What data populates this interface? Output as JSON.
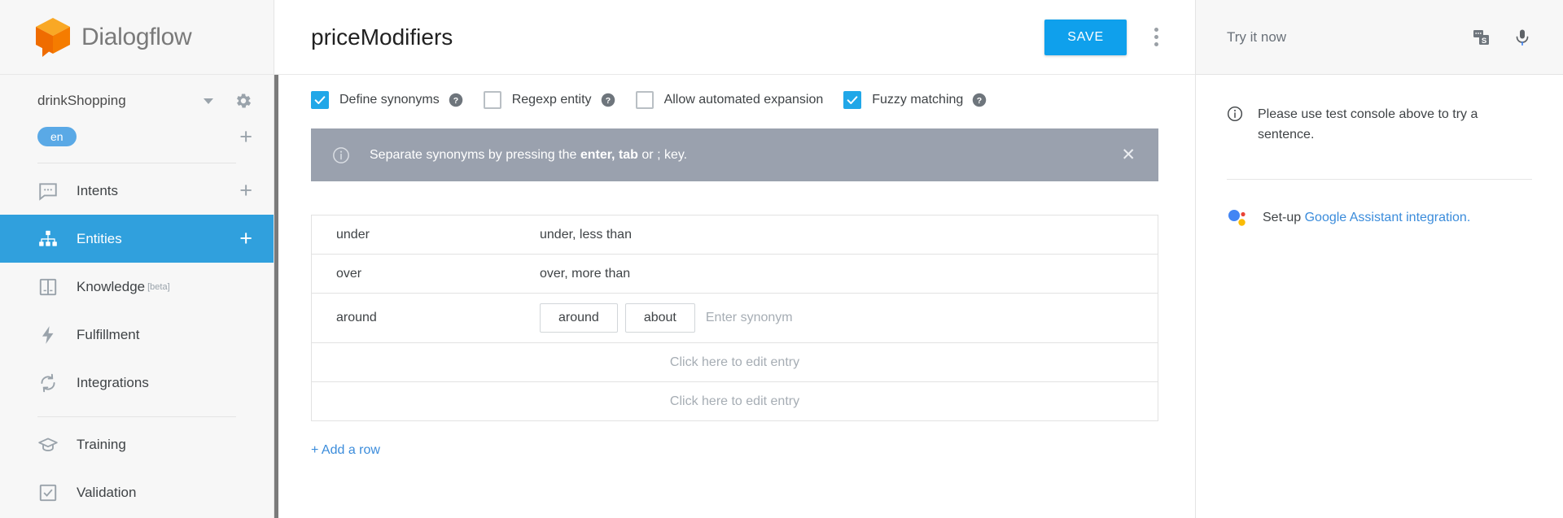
{
  "brand": {
    "name": "Dialogflow",
    "logo_icon": "dialogflow-cube-logo",
    "accent_color": "#f79c1b",
    "logo_text_color": "#7a7a7a"
  },
  "sidebar": {
    "agent": {
      "name": "drinkShopping",
      "dropdown_icon": "chevron-down-icon",
      "settings_icon": "gear-icon"
    },
    "language": {
      "chip": "en",
      "add_icon": "plus-icon",
      "chip_color": "#5aa9e6"
    },
    "items": [
      {
        "label": "Intents",
        "icon": "chat-bubble-icon",
        "active": false,
        "has_add": true
      },
      {
        "label": "Entities",
        "icon": "sitemap-icon",
        "active": true,
        "has_add": true
      },
      {
        "label": "Knowledge",
        "icon": "book-icon",
        "active": false,
        "badge": "[beta]",
        "has_add": false
      },
      {
        "label": "Fulfillment",
        "icon": "lightning-bolt-icon",
        "active": false,
        "has_add": false
      },
      {
        "label": "Integrations",
        "icon": "refresh-cycle-icon",
        "active": false,
        "has_add": false
      },
      {
        "label": "Training",
        "icon": "graduation-cap-icon",
        "active": false,
        "has_add": false
      },
      {
        "label": "Validation",
        "icon": "checkbox-check-icon",
        "active": false,
        "has_add": false
      }
    ],
    "active_color": "#30a0dd"
  },
  "header": {
    "title": "priceModifiers",
    "save_label": "SAVE",
    "save_color": "#0fa0ec",
    "overflow_icon": "kebab-menu-icon"
  },
  "options": [
    {
      "label": "Define synonyms",
      "checked": true,
      "help": "help-icon"
    },
    {
      "label": "Regexp entity",
      "checked": false,
      "help": "help-icon"
    },
    {
      "label": "Allow automated expansion",
      "checked": false,
      "help": null
    },
    {
      "label": "Fuzzy matching",
      "checked": true,
      "help": "help-icon"
    }
  ],
  "banner": {
    "icon": "info-circle-icon",
    "text_before": "Separate synonyms by pressing the ",
    "text_bold": "enter, tab",
    "text_after": " or ; key.",
    "close_icon": "close-x-icon",
    "background": "#9aa1ae"
  },
  "table": {
    "rows": [
      {
        "type": "value",
        "reference": "under",
        "synonyms": "under, less than"
      },
      {
        "type": "value",
        "reference": "over",
        "synonyms": "over, more than"
      },
      {
        "type": "editing",
        "reference": "around",
        "chips": [
          "around",
          "about"
        ],
        "input_value": "",
        "input_placeholder": "Enter synonym"
      },
      {
        "type": "empty",
        "placeholder": "Click here to edit entry"
      },
      {
        "type": "empty",
        "placeholder": "Click here to edit entry"
      }
    ],
    "add_row_label": "+ Add a row",
    "link_color": "#3b8cdb"
  },
  "right_panel": {
    "title": "Try it now",
    "icons": [
      {
        "name": "test-console-icon"
      },
      {
        "name": "microphone-icon"
      }
    ],
    "note": {
      "icon": "info-circle-icon",
      "text": "Please use test console above to try a sentence."
    },
    "assistant": {
      "icon": "google-assistant-dots-icon",
      "prefix": "Set-up ",
      "link": "Google Assistant integration.",
      "link_color": "#3b8cdb"
    }
  }
}
